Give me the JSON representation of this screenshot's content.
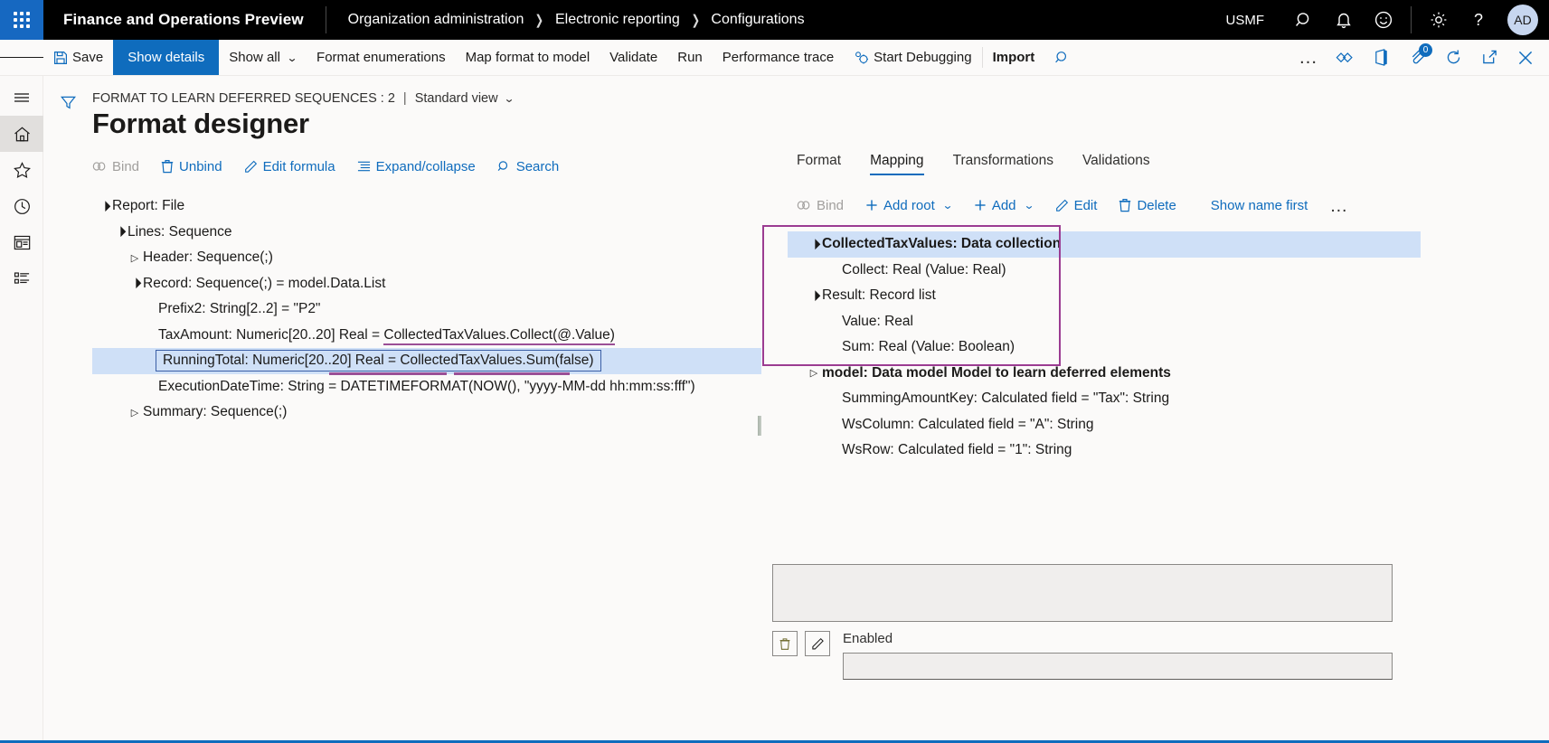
{
  "topbar": {
    "waffle_label": "app-launcher",
    "app_title": "Finance and Operations Preview",
    "breadcrumb": [
      "Organization administration",
      "Electronic reporting",
      "Configurations"
    ],
    "company": "USMF",
    "avatar_initials": "AD"
  },
  "commandbar": {
    "save_label": "Save",
    "show_details_label": "Show details",
    "show_all_label": "Show all",
    "format_enumerations_label": "Format enumerations",
    "map_format_to_model_label": "Map format to model",
    "validate_label": "Validate",
    "run_label": "Run",
    "performance_trace_label": "Performance trace",
    "start_debugging_label": "Start Debugging",
    "import_label": "Import",
    "overflow_label": "…",
    "notification_count": "0"
  },
  "page": {
    "subtitle": "FORMAT TO LEARN DEFERRED SEQUENCES : 2",
    "subtitle_separator": "|",
    "view_label": "Standard view",
    "title": "Format designer"
  },
  "format_toolbar": {
    "bind": "Bind",
    "unbind": "Unbind",
    "edit_formula": "Edit formula",
    "expand_collapse": "Expand/collapse",
    "search": "Search"
  },
  "format_tree": [
    {
      "indent": 0,
      "twisty": "open",
      "text": "Report: File",
      "selected": false
    },
    {
      "indent": 1,
      "twisty": "open",
      "text": "Lines: Sequence",
      "selected": false
    },
    {
      "indent": 2,
      "twisty": "closed",
      "text": "Header: Sequence(;)",
      "selected": false
    },
    {
      "indent": 2,
      "twisty": "open",
      "text": "Record: Sequence(;) = model.Data.List",
      "selected": false
    },
    {
      "indent": 3,
      "twisty": "none",
      "text": "Prefix2: String[2..2] = \"P2\"",
      "selected": false
    },
    {
      "indent": 3,
      "twisty": "none",
      "text": "TaxAmount: Numeric[20..20] Real = ",
      "underlined": "CollectedTaxValues.Collect(@.Value)",
      "selected": false
    },
    {
      "indent": 3,
      "twisty": "none",
      "text": "RunningTotal: Numeric[20..20] Real = CollectedTaxValues.Sum(false)",
      "selected": true
    },
    {
      "indent": 3,
      "twisty": "none",
      "text": "ExecutionDateTime: String = DATETIMEFORMAT(NOW(), \"yyyy-MM-dd hh:mm:ss:fff\")",
      "selected": false
    },
    {
      "indent": 2,
      "twisty": "closed",
      "text": "Summary: Sequence(;)",
      "selected": false
    }
  ],
  "mapping": {
    "tabs": [
      {
        "label": "Format",
        "active": false
      },
      {
        "label": "Mapping",
        "active": true
      },
      {
        "label": "Transformations",
        "active": false
      },
      {
        "label": "Validations",
        "active": false
      }
    ],
    "toolbar": {
      "bind": "Bind",
      "add_root": "Add root",
      "add": "Add",
      "edit": "Edit",
      "delete": "Delete",
      "show_name_first": "Show name first",
      "overflow": "…"
    },
    "tree": [
      {
        "indent": 0,
        "twisty": "open",
        "text": "CollectedTaxValues: Data collection",
        "selected": true,
        "bold": true
      },
      {
        "indent": 1,
        "twisty": "none",
        "text": "Collect: Real (Value: Real)",
        "selected": false
      },
      {
        "indent": 0,
        "twisty": "open",
        "text": "Result: Record list",
        "selected": false
      },
      {
        "indent": 1,
        "twisty": "none",
        "text": "Value: Real",
        "selected": false
      },
      {
        "indent": 1,
        "twisty": "none",
        "text": "Sum: Real (Value: Boolean)",
        "selected": false
      },
      {
        "indent": 0,
        "twisty": "closed",
        "text": "model: Data model Model to learn deferred elements",
        "selected": false,
        "bold": true
      },
      {
        "indent": 1,
        "twisty": "none",
        "text": "SummingAmountKey: Calculated field = \"Tax\": String",
        "selected": false
      },
      {
        "indent": 1,
        "twisty": "none",
        "text": "WsColumn: Calculated field = \"A\": String",
        "selected": false
      },
      {
        "indent": 1,
        "twisty": "none",
        "text": "WsRow: Calculated field = \"1\": String",
        "selected": false
      }
    ]
  },
  "details": {
    "formula_value": "",
    "enabled_label": "Enabled",
    "enabled_value": ""
  },
  "colors": {
    "accent": "#0f6cbd",
    "highlight_box": "#9b3c92",
    "selection": "#cfe0f7",
    "underline": "#9b4f96",
    "topbar_bg": "#000000"
  }
}
